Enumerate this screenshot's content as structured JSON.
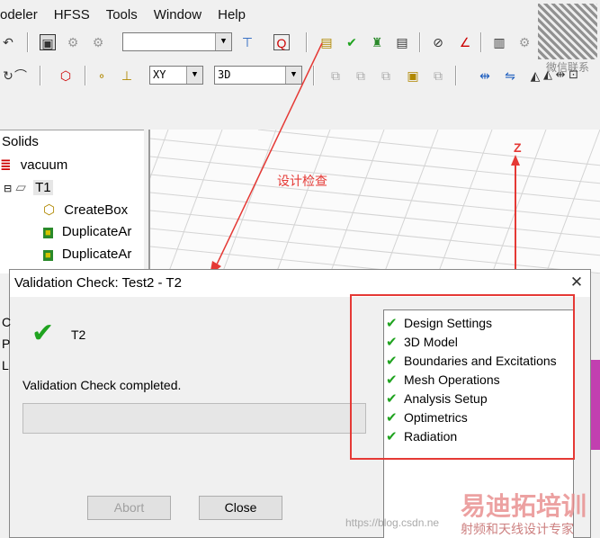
{
  "menu": [
    "odeler",
    "HFSS",
    "Tools",
    "Window",
    "Help"
  ],
  "toolbar": {
    "plane_select": "XY",
    "view_select": "3D",
    "combo_empty": ""
  },
  "tree": {
    "header": "Solids",
    "items": [
      {
        "label": "vacuum",
        "icon": "material-stack-icon"
      },
      {
        "label": "T1",
        "icon": "solid-object-icon"
      },
      {
        "label": "CreateBox",
        "icon": "create-box-icon"
      },
      {
        "label": "DuplicateAr",
        "icon": "duplicate-icon"
      },
      {
        "label": "DuplicateAr",
        "icon": "duplicate-icon"
      }
    ],
    "side_letters": [
      "C",
      "P",
      "L"
    ]
  },
  "viewport": {
    "axis_label": "Z"
  },
  "annotation": {
    "text": "设计检查",
    "color": "#e53935"
  },
  "dialog": {
    "title": "Validation Check: Test2 - T2",
    "close_glyph": "✕",
    "project": "T2",
    "status": "Validation Check completed.",
    "abort_label": "Abort",
    "close_label": "Close",
    "checks": [
      "Design Settings",
      "3D Model",
      "Boundaries and Excitations",
      "Mesh Operations",
      "Analysis Setup",
      "Optimetrics",
      "Radiation"
    ]
  },
  "watermark": {
    "url": "https://blog.csdn.ne",
    "brand": "易迪拓培训",
    "slogan": "射频和天线设计专家",
    "qr_caption": "微信联系"
  }
}
